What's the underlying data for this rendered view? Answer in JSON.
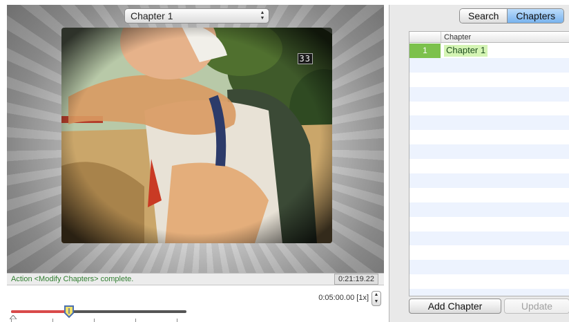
{
  "player": {
    "chapter_select_value": "Chapter 1",
    "video_counter": "33",
    "status_text": "Action <Modify Chapters> complete.",
    "timecode": "0:21:19.22",
    "position_readout": "0:05:00.00 [1x]",
    "scrub_progress": 0.33
  },
  "panel": {
    "tabs": [
      {
        "label": "Search",
        "active": false
      },
      {
        "label": "Chapters",
        "active": true
      }
    ],
    "table": {
      "column_header": "Chapter",
      "rows": [
        {
          "index": "1",
          "name": "Chapter 1"
        }
      ]
    },
    "add_chapter_label": "Add Chapter",
    "update_label": "Update"
  },
  "colors": {
    "status_text": "#2f7d2f",
    "row_index_bg": "#7cc14c",
    "row_name_bg": "#d4f4b4",
    "active_tab": "#78b3ee",
    "scrub_fill": "#d94a4a"
  }
}
